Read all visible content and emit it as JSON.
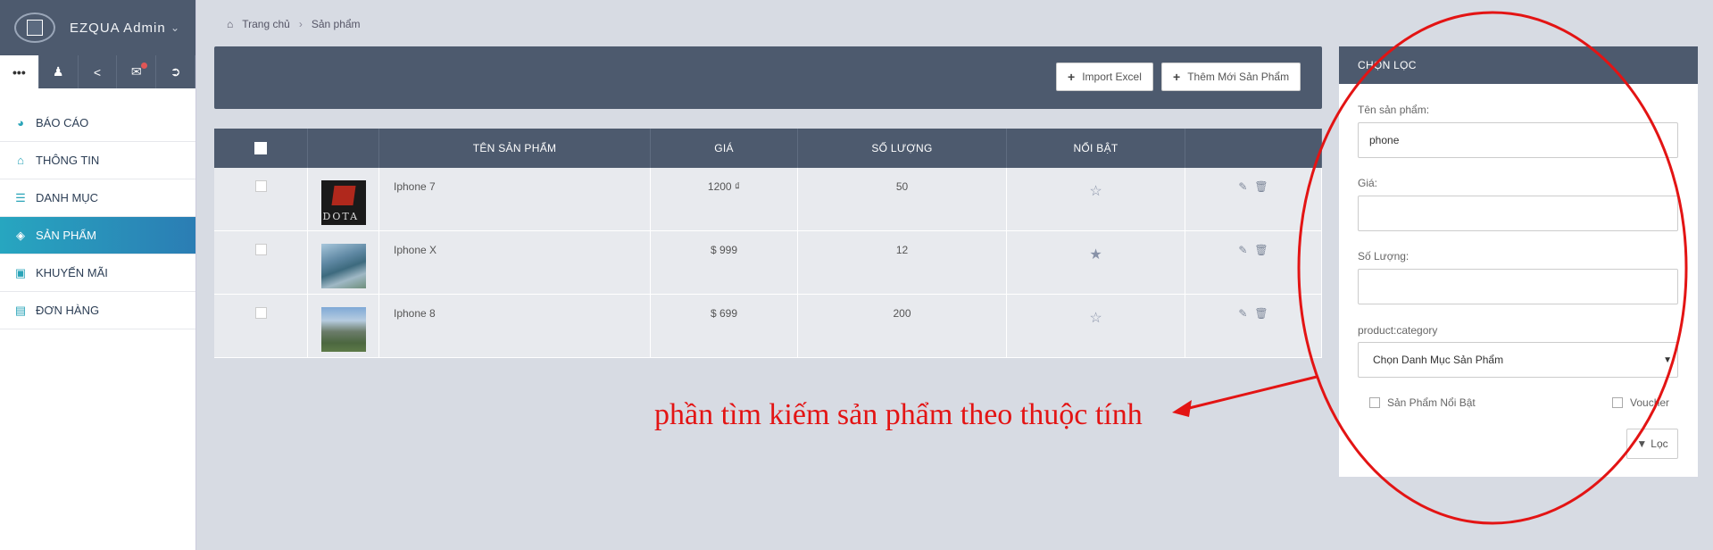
{
  "app": {
    "title": "EZQUA Admin"
  },
  "colors": {
    "header": "#4d5a6e",
    "accent": "#27a6c0",
    "annotation": "#e31414",
    "background": "#d7dbe3"
  },
  "icon_bar": [
    {
      "name": "more-icon",
      "glyph": "•••"
    },
    {
      "name": "user-icon",
      "glyph": "👤"
    },
    {
      "name": "share-icon",
      "glyph": "⋖"
    },
    {
      "name": "mail-icon",
      "glyph": "✉"
    },
    {
      "name": "logout-icon",
      "glyph": "⇥"
    }
  ],
  "sidebar": {
    "items": [
      {
        "label": "BÁO CÁO",
        "icon": "dashboard-icon",
        "glyph": "◕"
      },
      {
        "label": "THÔNG TIN",
        "icon": "home-icon",
        "glyph": "⌂"
      },
      {
        "label": "DANH MỤC",
        "icon": "list-icon",
        "glyph": "☰"
      },
      {
        "label": "SẢN PHẨM",
        "icon": "cube-icon",
        "glyph": "◈",
        "active": true
      },
      {
        "label": "KHUYẾN MÃI",
        "icon": "gift-icon",
        "glyph": "▣"
      },
      {
        "label": "ĐƠN HÀNG",
        "icon": "order-icon",
        "glyph": "▤"
      }
    ]
  },
  "breadcrumb": {
    "home": "Trang chủ",
    "separator": "›",
    "current": "Sản phẩm"
  },
  "toolbar": {
    "import_label": "Import Excel",
    "add_label": "Thêm Mới Sản Phẩm"
  },
  "table": {
    "headers": [
      "",
      "",
      "TÊN SẢN PHẨM",
      "GIÁ",
      "SỐ LƯỢNG",
      "NỔI BẬT",
      ""
    ],
    "rows": [
      {
        "name": "Iphone 7",
        "price": "1200 ₫",
        "quantity": "50",
        "featured": false,
        "thumb": "dota"
      },
      {
        "name": "Iphone X",
        "price": "$ 999",
        "quantity": "12",
        "featured": true,
        "thumb": "bay"
      },
      {
        "name": "Iphone 8",
        "price": "$ 699",
        "quantity": "200",
        "featured": false,
        "thumb": "mtn"
      }
    ]
  },
  "filter": {
    "title": "CHỌN LỌC",
    "name_label": "Tên sản phẩm:",
    "name_value": "phone",
    "price_label": "Giá:",
    "price_value": "",
    "qty_label": "Số Lượng:",
    "qty_value": "",
    "category_label": "product:category",
    "category_value": "Chọn Danh Mục Sản Phẩm",
    "featured_label": "Sản Phẩm Nổi Bật",
    "voucher_label": "Voucher",
    "filter_button": "Lọc"
  },
  "annotation": {
    "text": "phần tìm kiếm sản phẩm theo thuộc tính"
  }
}
